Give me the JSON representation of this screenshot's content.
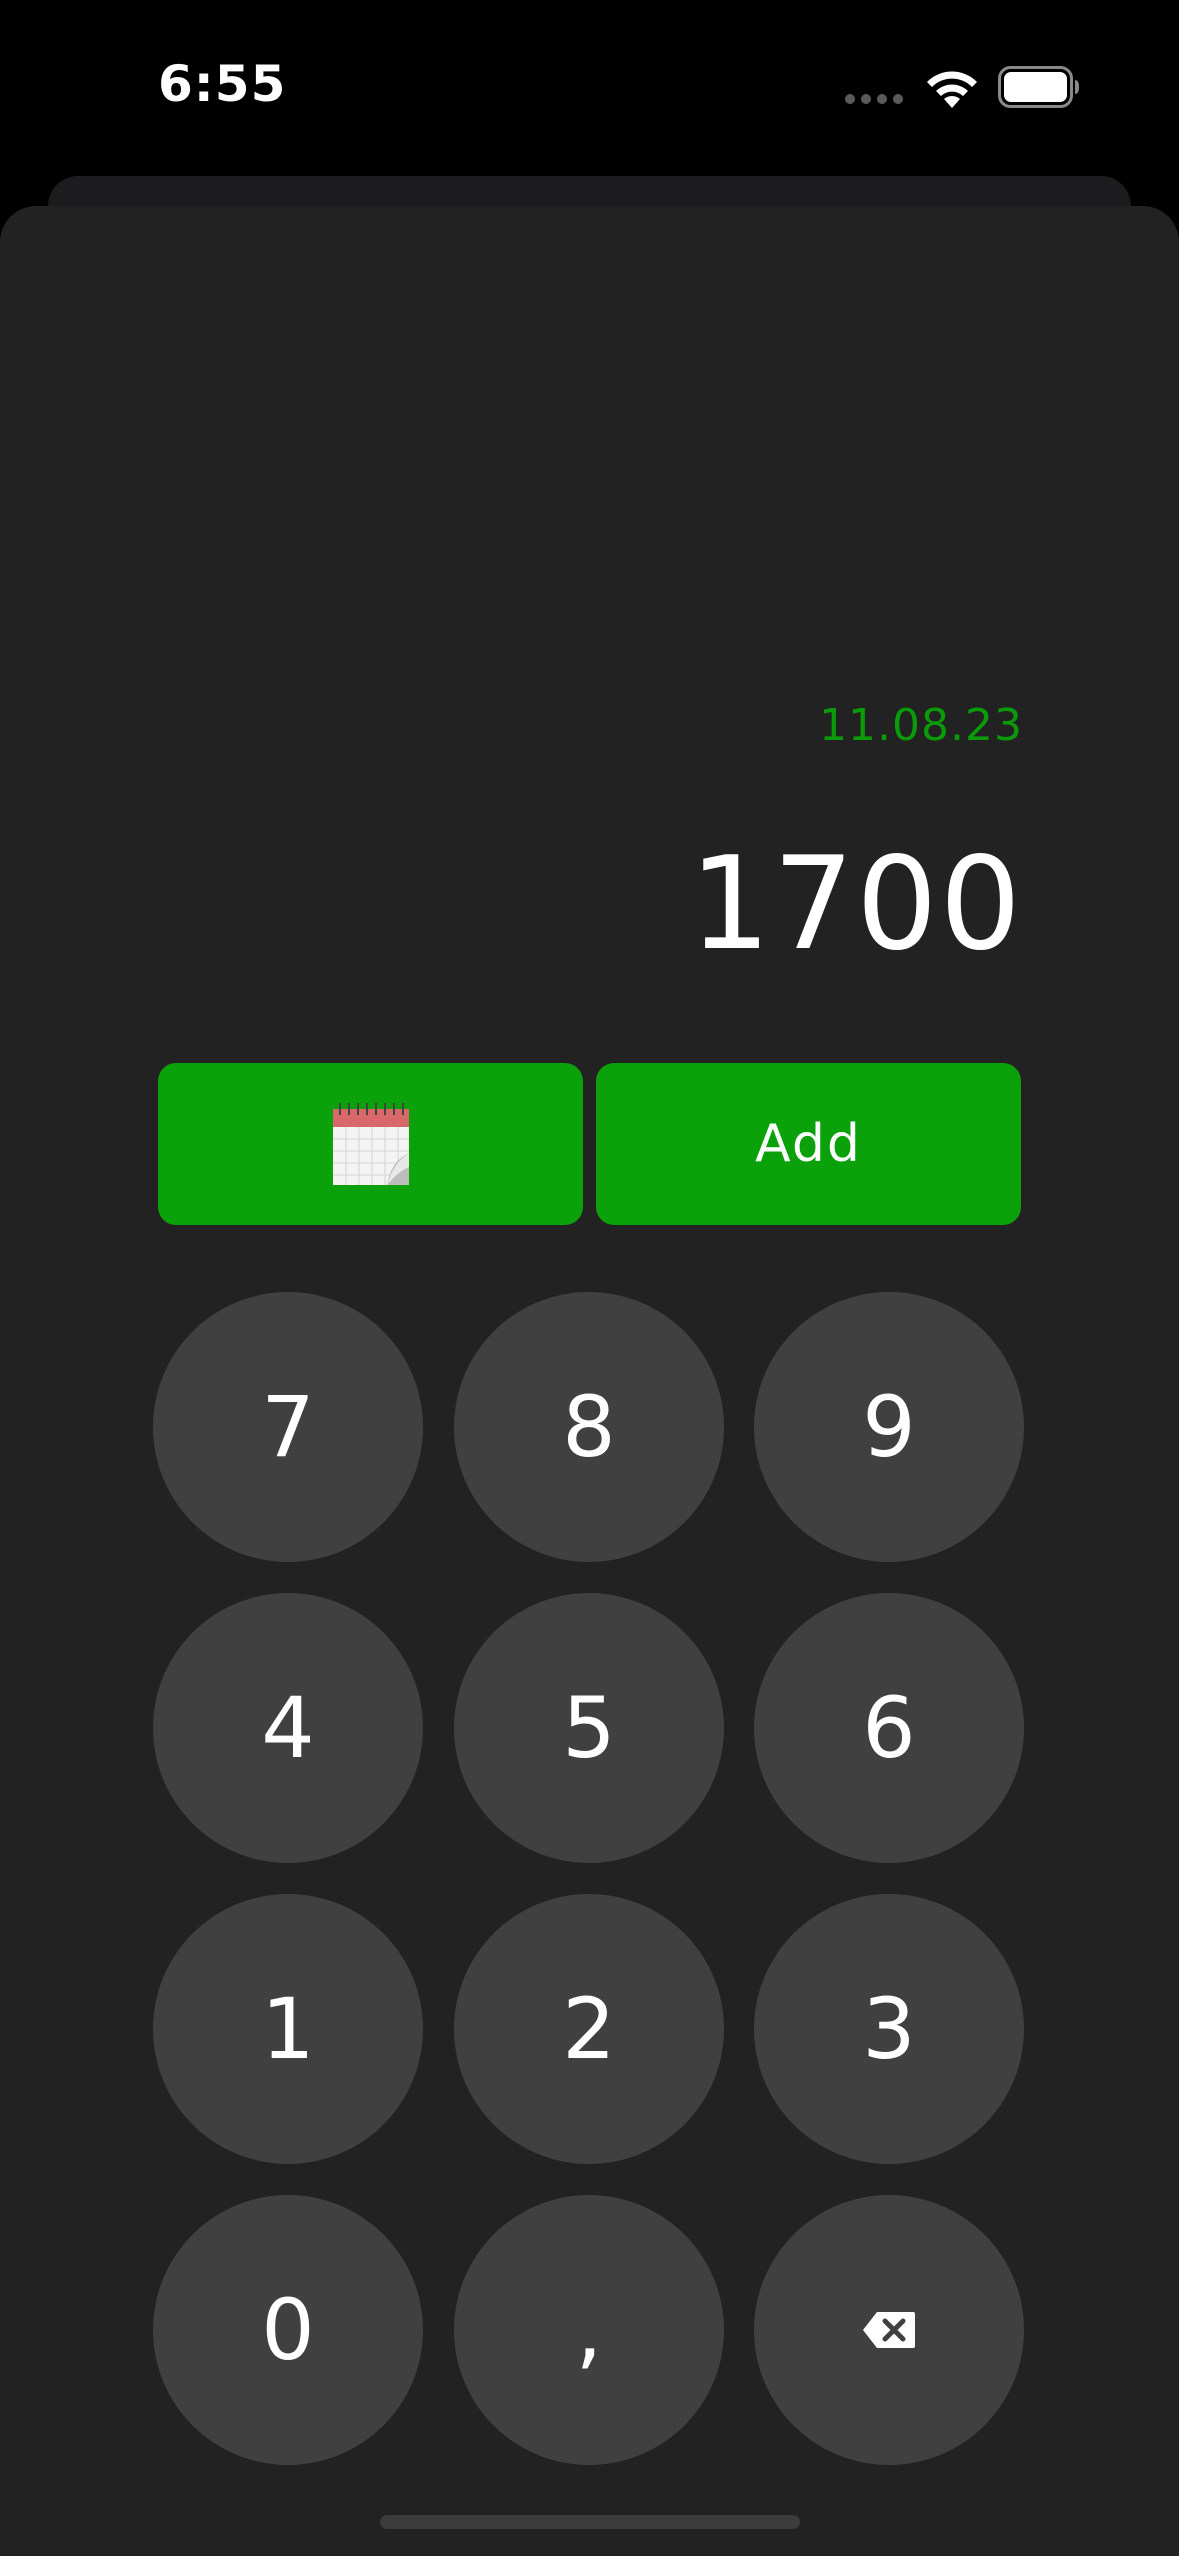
{
  "status_bar": {
    "time": "6:55"
  },
  "entry": {
    "date": "11.08.23",
    "amount": "1700"
  },
  "actions": {
    "calendar_icon": "calendar-icon",
    "add_label": "Add"
  },
  "keypad": {
    "keys": [
      {
        "label": "7",
        "name": "key-7"
      },
      {
        "label": "8",
        "name": "key-8"
      },
      {
        "label": "9",
        "name": "key-9"
      },
      {
        "label": "4",
        "name": "key-4"
      },
      {
        "label": "5",
        "name": "key-5"
      },
      {
        "label": "6",
        "name": "key-6"
      },
      {
        "label": "1",
        "name": "key-1"
      },
      {
        "label": "2",
        "name": "key-2"
      },
      {
        "label": "3",
        "name": "key-3"
      },
      {
        "label": "0",
        "name": "key-0"
      },
      {
        "label": ",",
        "name": "key-comma"
      }
    ],
    "backspace_icon": "backspace-icon"
  },
  "colors": {
    "accent": "#0aa10a",
    "date_text": "#0a9a0a",
    "sheet": "#222222",
    "key": "#404040"
  }
}
